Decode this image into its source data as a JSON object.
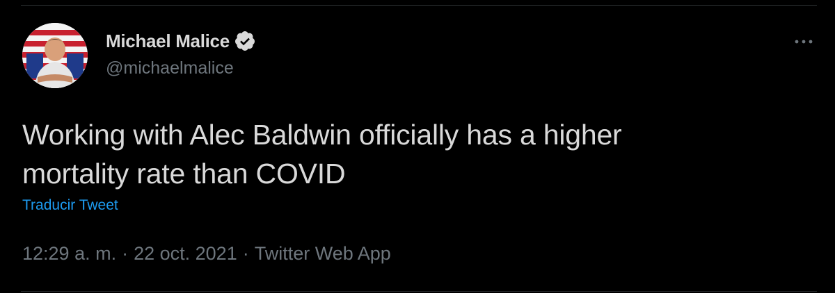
{
  "tweet": {
    "author": {
      "display_name": "Michael Malice",
      "handle": "@michaelmalice",
      "verified": true
    },
    "text_line1": "Working with Alec Baldwin officially has a higher",
    "text_line2": "mortality rate than COVID",
    "translate_label": "Traducir Tweet",
    "time": "12:29 a. m.",
    "date": "22 oct. 2021",
    "source": "Twitter Web App",
    "separator": "·"
  },
  "icons": {
    "verified": "verified-badge-icon",
    "more": "more-options-icon"
  },
  "colors": {
    "background": "#000000",
    "text": "#d9d9d9",
    "secondary": "#6e767d",
    "link": "#1d9bf0",
    "divider": "#2f3336"
  }
}
